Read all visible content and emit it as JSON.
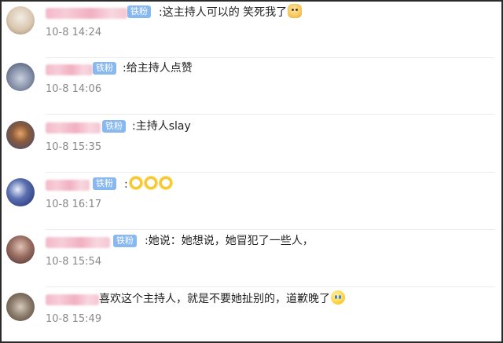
{
  "badge_label": "铁粉",
  "comments": [
    {
      "text": ":这主持人可以的 笑死我了",
      "emoji": "doge-icon",
      "time": "10-8 14:24",
      "avatar_color": "#d9c7b0"
    },
    {
      "text": ":给主持人点赞",
      "emoji": "",
      "time": "10-8 14:06",
      "avatar_color": "#7f8aa3"
    },
    {
      "text": ":主持人slay",
      "emoji": "",
      "time": "10-8 15:35",
      "avatar_color": "#3b4a7a"
    },
    {
      "text": ":",
      "emoji": "ring-emoji-x3",
      "time": "10-8 16:17",
      "avatar_color": "#1c2b6e"
    },
    {
      "text": ":她说：她想说，她冒犯了一些人，",
      "emoji": "",
      "time": "10-8 15:54",
      "avatar_color": "#6b4a45"
    },
    {
      "text": "喜欢这个主持人，就是不要她扯别的，道歉晚了",
      "emoji": "crying-face-icon",
      "time": "10-8 15:49",
      "avatar_color": "#8a7a6a"
    }
  ]
}
